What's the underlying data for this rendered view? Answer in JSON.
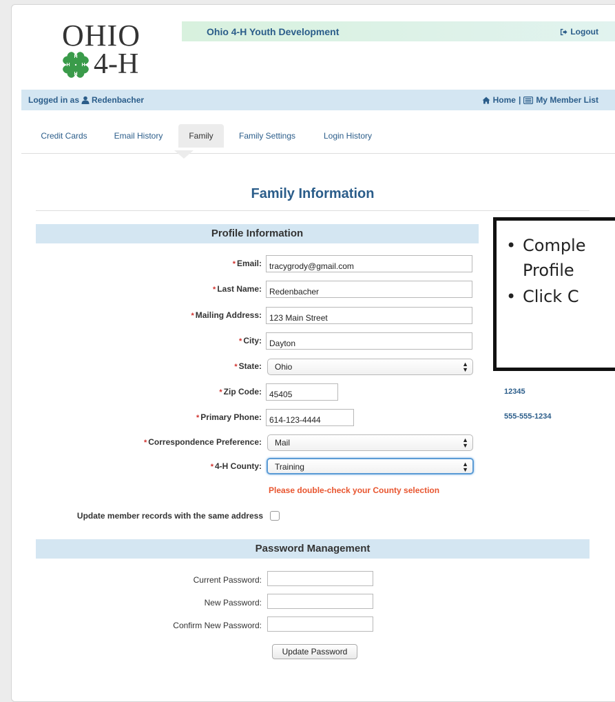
{
  "header": {
    "logo_ohio": "OHIO",
    "logo_4h": "4-H",
    "site_title": "Ohio 4-H Youth Development",
    "logout_label": "Logout"
  },
  "login_bar": {
    "logged_in_prefix": "Logged in as",
    "username": "Redenbacher",
    "home_label": "Home",
    "separator": "|",
    "member_list_label": "My Member List"
  },
  "tabs": [
    {
      "label": "Credit Cards",
      "active": false
    },
    {
      "label": "Email History",
      "active": false
    },
    {
      "label": "Family",
      "active": true
    },
    {
      "label": "Family Settings",
      "active": false
    },
    {
      "label": "Login History",
      "active": false
    }
  ],
  "page_title": "Family Information",
  "profile": {
    "section_title": "Profile Information",
    "fields": {
      "email": {
        "label": "Email:",
        "value": "tracygrody@gmail.com"
      },
      "last_name": {
        "label": "Last Name:",
        "value": "Redenbacher"
      },
      "mailing_address": {
        "label": "Mailing Address:",
        "value": "123 Main Street"
      },
      "city": {
        "label": "City:",
        "value": "Dayton"
      },
      "state": {
        "label": "State:",
        "value": "Ohio"
      },
      "zip": {
        "label": "Zip Code:",
        "value": "45405",
        "side_value": "12345"
      },
      "phone": {
        "label": "Primary Phone:",
        "value": "614-123-4444",
        "side_value": "555-555-1234"
      },
      "correspondence": {
        "label": "Correspondence Preference:",
        "value": "Mail"
      },
      "county": {
        "label": "4-H County:",
        "value": "Training"
      }
    },
    "required_marker": "*",
    "county_warning": "Please double-check your County selection",
    "update_member_label": "Update member records with the same address",
    "update_member_checked": false
  },
  "password": {
    "section_title": "Password Management",
    "current_label": "Current Password:",
    "new_label": "New Password:",
    "confirm_label": "Confirm New Password:",
    "button_label": "Update Password"
  },
  "callout": {
    "bullet": "•",
    "line1": "Comple",
    "line2": "Profile",
    "line3": "Click C"
  },
  "colors": {
    "accent": "#2b5d8a",
    "required": "#d0312d",
    "warning": "#e8552f",
    "bar": "#d4e6f2",
    "clover": "#3a9b4a"
  },
  "icons": {
    "logout": "sign-out-icon",
    "user": "user-icon",
    "home": "home-icon",
    "list": "list-icon"
  }
}
